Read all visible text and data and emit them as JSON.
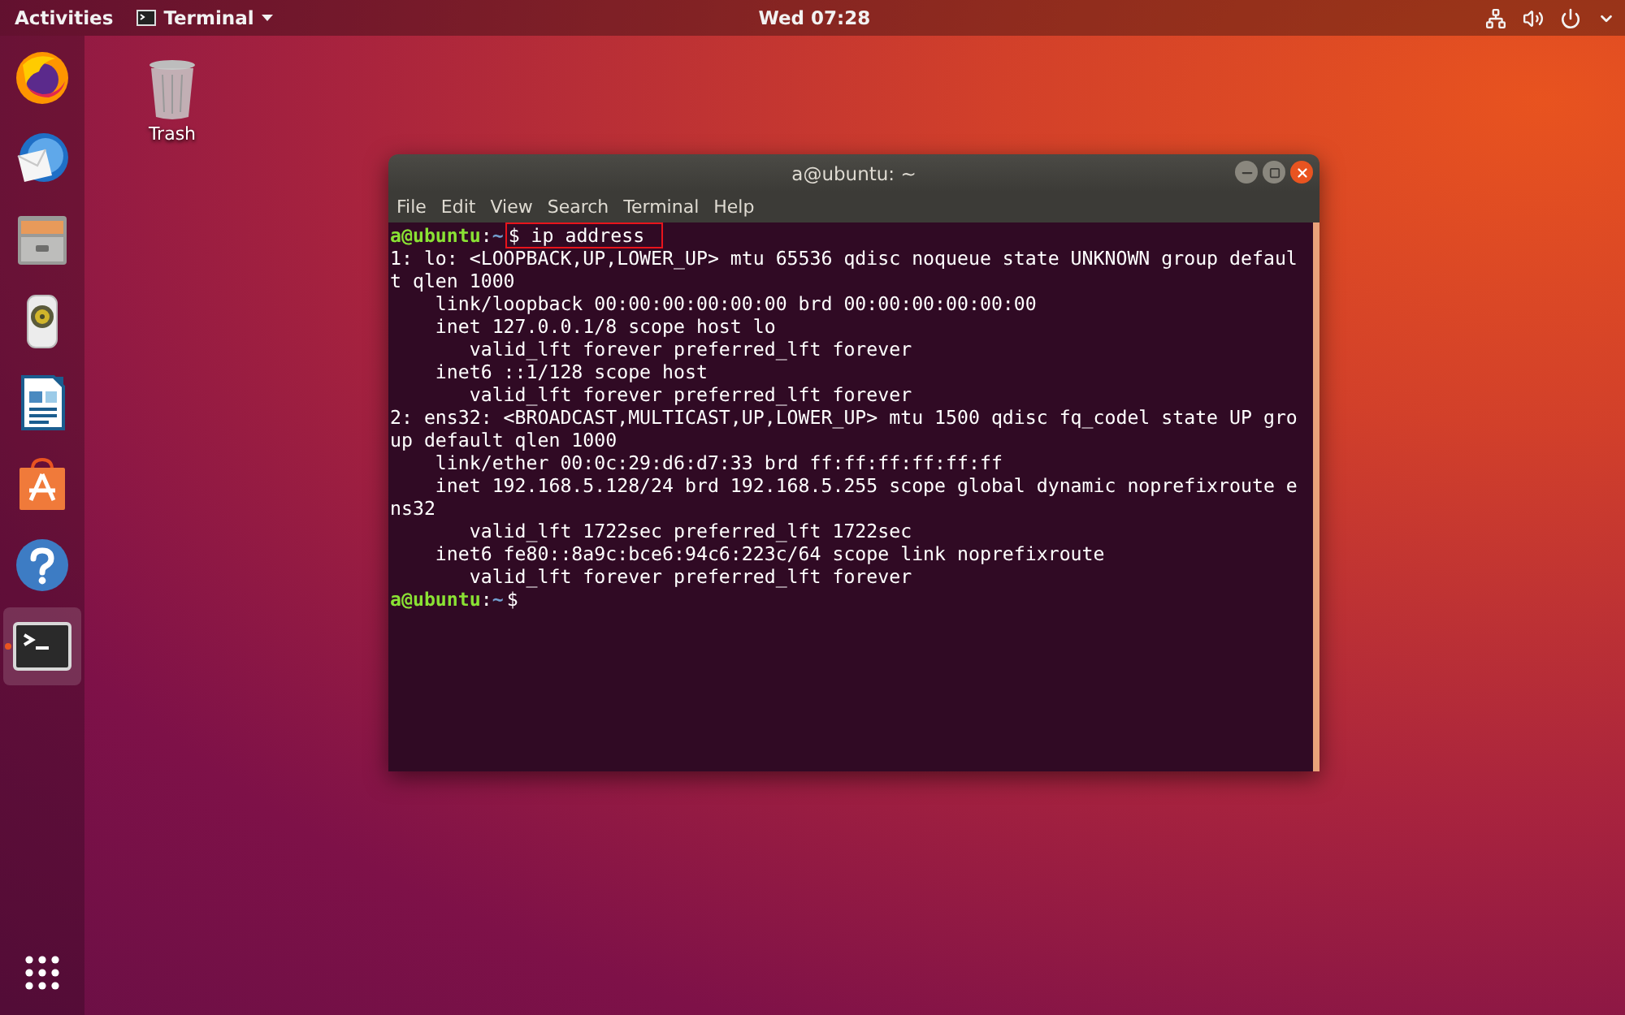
{
  "top_bar": {
    "activities": "Activities",
    "app_menu": "Terminal",
    "clock": "Wed 07:28"
  },
  "dock": {
    "items": [
      {
        "kind": "browser",
        "running": false
      },
      {
        "kind": "mail",
        "running": false
      },
      {
        "kind": "files",
        "running": false
      },
      {
        "kind": "music",
        "running": false
      },
      {
        "kind": "writer",
        "running": false
      },
      {
        "kind": "store",
        "running": false
      },
      {
        "kind": "help",
        "running": false
      },
      {
        "kind": "terminal",
        "running": true
      }
    ]
  },
  "desktop_icons": [
    {
      "label": "Trash"
    }
  ],
  "terminal": {
    "title": "a@ubuntu: ~",
    "menu": [
      "File",
      "Edit",
      "View",
      "Search",
      "Terminal",
      "Help"
    ],
    "lines": [
      {
        "kind": "prompt",
        "user": "a@ubuntu",
        "sep": ":",
        "path": "~",
        "command": "$ ip address",
        "highlighted": true
      },
      {
        "kind": "output",
        "text": "1: lo: <LOOPBACK,UP,LOWER_UP> mtu 65536 qdisc noqueue state UNKNOWN group defaul"
      },
      {
        "kind": "output",
        "text": "t qlen 1000"
      },
      {
        "kind": "output",
        "text": "    link/loopback 00:00:00:00:00:00 brd 00:00:00:00:00:00"
      },
      {
        "kind": "output",
        "text": "    inet 127.0.0.1/8 scope host lo"
      },
      {
        "kind": "output",
        "text": "       valid_lft forever preferred_lft forever"
      },
      {
        "kind": "output",
        "text": "    inet6 ::1/128 scope host"
      },
      {
        "kind": "output",
        "text": "       valid_lft forever preferred_lft forever"
      },
      {
        "kind": "output",
        "text": "2: ens32: <BROADCAST,MULTICAST,UP,LOWER_UP> mtu 1500 qdisc fq_codel state UP gro"
      },
      {
        "kind": "output",
        "text": "up default qlen 1000"
      },
      {
        "kind": "output",
        "text": "    link/ether 00:0c:29:d6:d7:33 brd ff:ff:ff:ff:ff:ff"
      },
      {
        "kind": "output",
        "text": "    inet 192.168.5.128/24 brd 192.168.5.255 scope global dynamic noprefixroute e"
      },
      {
        "kind": "output",
        "text": "ns32"
      },
      {
        "kind": "output",
        "text": "       valid_lft 1722sec preferred_lft 1722sec"
      },
      {
        "kind": "output",
        "text": "    inet6 fe80::8a9c:bce6:94c6:223c/64 scope link noprefixroute"
      },
      {
        "kind": "output",
        "text": "       valid_lft forever preferred_lft forever"
      },
      {
        "kind": "prompt",
        "user": "a@ubuntu",
        "sep": ":",
        "path": "~",
        "command": "$",
        "highlighted": false
      }
    ]
  }
}
